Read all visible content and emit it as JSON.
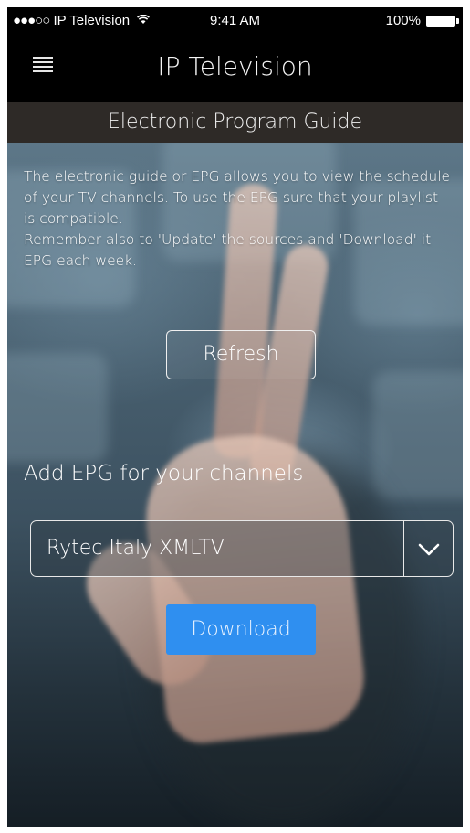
{
  "status_bar": {
    "signal": "●●●○○",
    "carrier": "IP Television",
    "wifi_icon": "wifi-icon",
    "time": "9:41 AM",
    "battery": "100%"
  },
  "nav": {
    "menu_icon": "menu-icon",
    "title": "IP Television"
  },
  "subheader": {
    "title": "Electronic Program Guide"
  },
  "description": {
    "line1": "The electronic guide or EPG allows you to view the schedule of your TV channels. To use the EPG sure that your playlist is compatible.",
    "line2": "Remember also to 'Update' the sources and 'Download' it EPG each week."
  },
  "refresh_button": {
    "label": "Refresh"
  },
  "add_epg": {
    "label": "Add EPG for your channels"
  },
  "epg_select": {
    "value": "Rytec Italy XMLTV",
    "icon": "chevron-down-icon"
  },
  "download_button": {
    "label": "Download",
    "color": "#2f8ff0"
  }
}
